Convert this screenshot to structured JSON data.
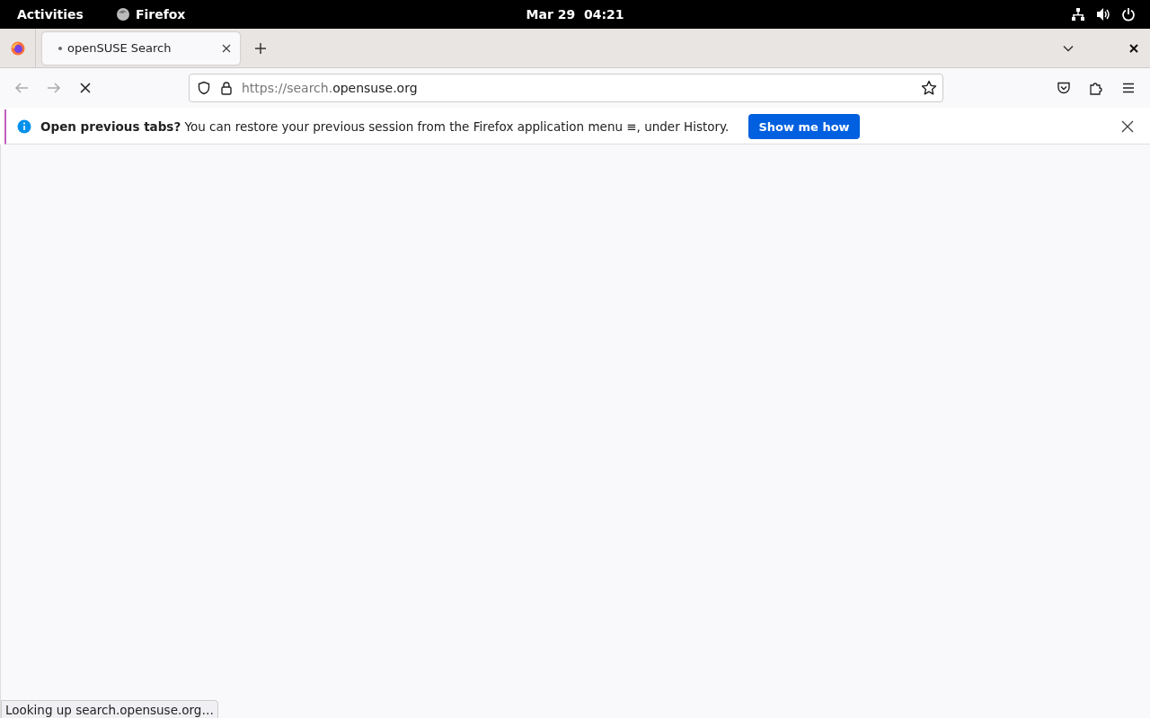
{
  "top_bar": {
    "activities": "Activities",
    "app_name": "Firefox",
    "clock": "Mar 29  04:21"
  },
  "tabs": [
    {
      "title": "openSUSE Search",
      "selected": true,
      "loading": true
    }
  ],
  "toolbar": {
    "back_disabled": true,
    "forward_disabled": true,
    "url": {
      "prefix": "https://search.",
      "domain": "opensuse.org"
    }
  },
  "notification": {
    "title": "Open previous tabs?",
    "message": "You can restore your previous session from the Firefox application menu ≡, under History.",
    "button": "Show me how"
  },
  "status_bar": {
    "text": "Looking up search.opensuse.org…"
  }
}
